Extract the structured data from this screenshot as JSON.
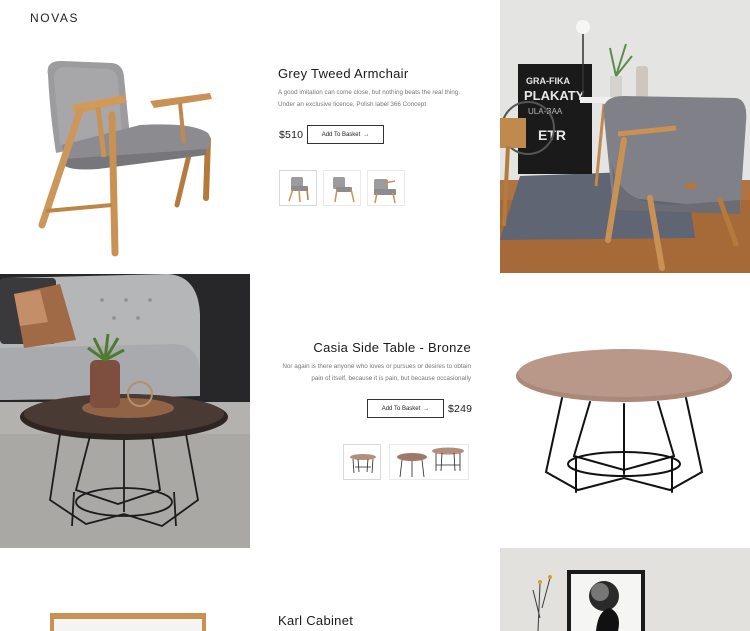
{
  "header": {
    "logo": "NOVAS",
    "menu_icon": "hamburger-icon"
  },
  "products": [
    {
      "title": "Grey Tweed Armchair",
      "description": "A good imitation can come close, but nothing beats the real thing. Under an exclusive licence, Polish label 366 Concept",
      "price": "$510",
      "button_label": "Add To Basket",
      "button_icon": "arrow-right-icon"
    },
    {
      "title": "Casia Side Table - Bronze",
      "description": "Nor again is there anyone who loves or pursues or desires to obtain pain of itself, because it is pain, but because occasionally",
      "price": "$249",
      "button_label": "Add To Basket",
      "button_icon": "arrow-right-icon"
    },
    {
      "title": "Karl Cabinet"
    }
  ],
  "colors": {
    "text": "#1a1a1a",
    "muted": "#777777",
    "wood": "#c99254",
    "fabric_grey": "#8e8e91",
    "bronze": "#b38f7b",
    "floor": "#b07442"
  }
}
